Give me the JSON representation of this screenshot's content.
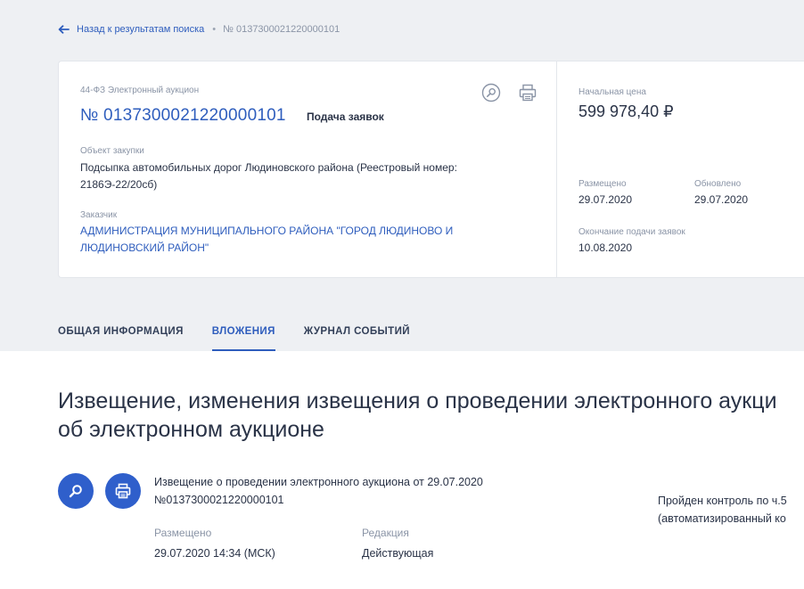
{
  "breadcrumb": {
    "back_label": "Назад к результатам поиска",
    "current": "№ 0137300021220000101"
  },
  "procurement": {
    "law_type": "44-ФЗ  Электронный аукцион",
    "number": "№ 0137300021220000101",
    "status": "Подача заявок",
    "object_label": "Объект закупки",
    "object_text": "Подсыпка автомобильных дорог Людиновского района (Реестровый номер: 2186Э-22/20сб)",
    "customer_label": "Заказчик",
    "customer_text": "АДМИНИСТРАЦИЯ МУНИЦИПАЛЬНОГО РАЙОНА \"ГОРОД ЛЮДИНОВО И ЛЮДИНОВСКИЙ РАЙОН\""
  },
  "summary": {
    "price_label": "Начальная цена",
    "price_value": "599 978,40 ₽",
    "placed_label": "Размещено",
    "placed_value": "29.07.2020",
    "updated_label": "Обновлено",
    "updated_value": "29.07.2020",
    "end_label": "Окончание подачи заявок",
    "end_value": "10.08.2020"
  },
  "tabs": [
    {
      "label": "ОБЩАЯ ИНФОРМАЦИЯ",
      "active": false
    },
    {
      "label": "ВЛОЖЕНИЯ",
      "active": true
    },
    {
      "label": "ЖУРНАЛ СОБЫТИЙ",
      "active": false
    }
  ],
  "attachments": {
    "section_title": "Извещение, изменения извещения о проведении электронного аукциона, протоколы об электронном аукционе",
    "section_title_line1": "Извещение, изменения извещения о проведении электронного аукци",
    "section_title_line2": "об электронном аукционе",
    "doc": {
      "title": "Извещение о проведении электронного аукциона от 29.07.2020 №0137300021220000101",
      "placed_label": "Размещено",
      "placed_value": "29.07.2020 14:34 (МСК)",
      "revision_label": "Редакция",
      "revision_value": "Действующая",
      "control_line1": "Пройден контроль по ч.5",
      "control_line2": "(автоматизированный ко"
    }
  },
  "colors": {
    "accent": "#2e5dbd",
    "button": "#2f5fcb",
    "background_top": "#eef0f3"
  },
  "icons": {
    "back": "arrow-left-icon",
    "search": "magnifier-icon",
    "print": "printer-icon"
  }
}
